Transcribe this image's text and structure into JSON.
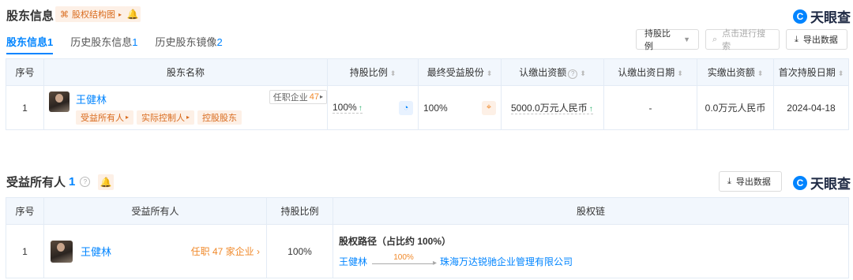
{
  "section1": {
    "title": "股东信息",
    "equity_chart_btn": "股权结构图",
    "logo": "天眼查",
    "tabs": [
      {
        "label": "股东信息",
        "count": "1"
      },
      {
        "label": "历史股东信息",
        "count": "1"
      },
      {
        "label": "历史股东镜像",
        "count": "2"
      }
    ],
    "filter_label": "持股比例",
    "search_placeholder": "点击进行搜索",
    "export_label": "导出数据",
    "headers": [
      "序号",
      "股东名称",
      "持股比例",
      "最终受益股份",
      "认缴出资额",
      "认缴出资日期",
      "实缴出资额",
      "首次持股日期"
    ],
    "row": {
      "index": "1",
      "name": "王健林",
      "related_label": "任职企业",
      "related_count": "47",
      "tags": [
        "受益所有人",
        "实际控制人",
        "控股股东"
      ],
      "share_ratio": "100%",
      "final_benefit": "100%",
      "subscribed": "5000.0万元人民币",
      "subscribed_date": "-",
      "paid": "0.0万元人民币",
      "first_date": "2024-04-18"
    }
  },
  "section2": {
    "title": "受益所有人",
    "count": "1",
    "export_label": "导出数据",
    "logo": "天眼查",
    "headers": [
      "序号",
      "受益所有人",
      "持股比例",
      "股权链"
    ],
    "row": {
      "index": "1",
      "name": "王健林",
      "job_link": "任职 47 家企业",
      "ratio": "100%",
      "path_title": "股权路径（占比约 100%）",
      "chain_from": "王健林",
      "chain_pct": "100%",
      "chain_to": "珠海万达锐驰企业管理有限公司"
    }
  }
}
